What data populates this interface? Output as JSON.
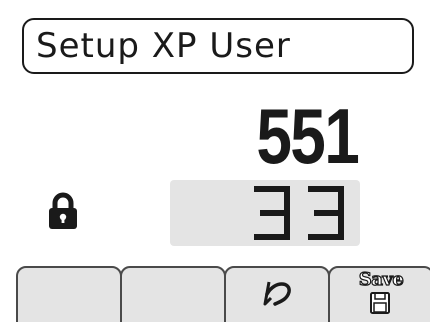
{
  "screen": {
    "title": "Setup XP User",
    "primary_value": "551",
    "secondary_value": "33",
    "lock_icon": "lock-icon"
  },
  "softkeys": [
    {
      "label": "",
      "icon": ""
    },
    {
      "label": "",
      "icon": ""
    },
    {
      "label": "",
      "icon": "undo-icon"
    },
    {
      "label": "Save",
      "icon": "save-icon"
    }
  ],
  "colors": {
    "foreground": "#1a1a1a",
    "field_background": "#e4e4e4",
    "softkey_border": "#4a4a4a",
    "background": "#ffffff"
  }
}
